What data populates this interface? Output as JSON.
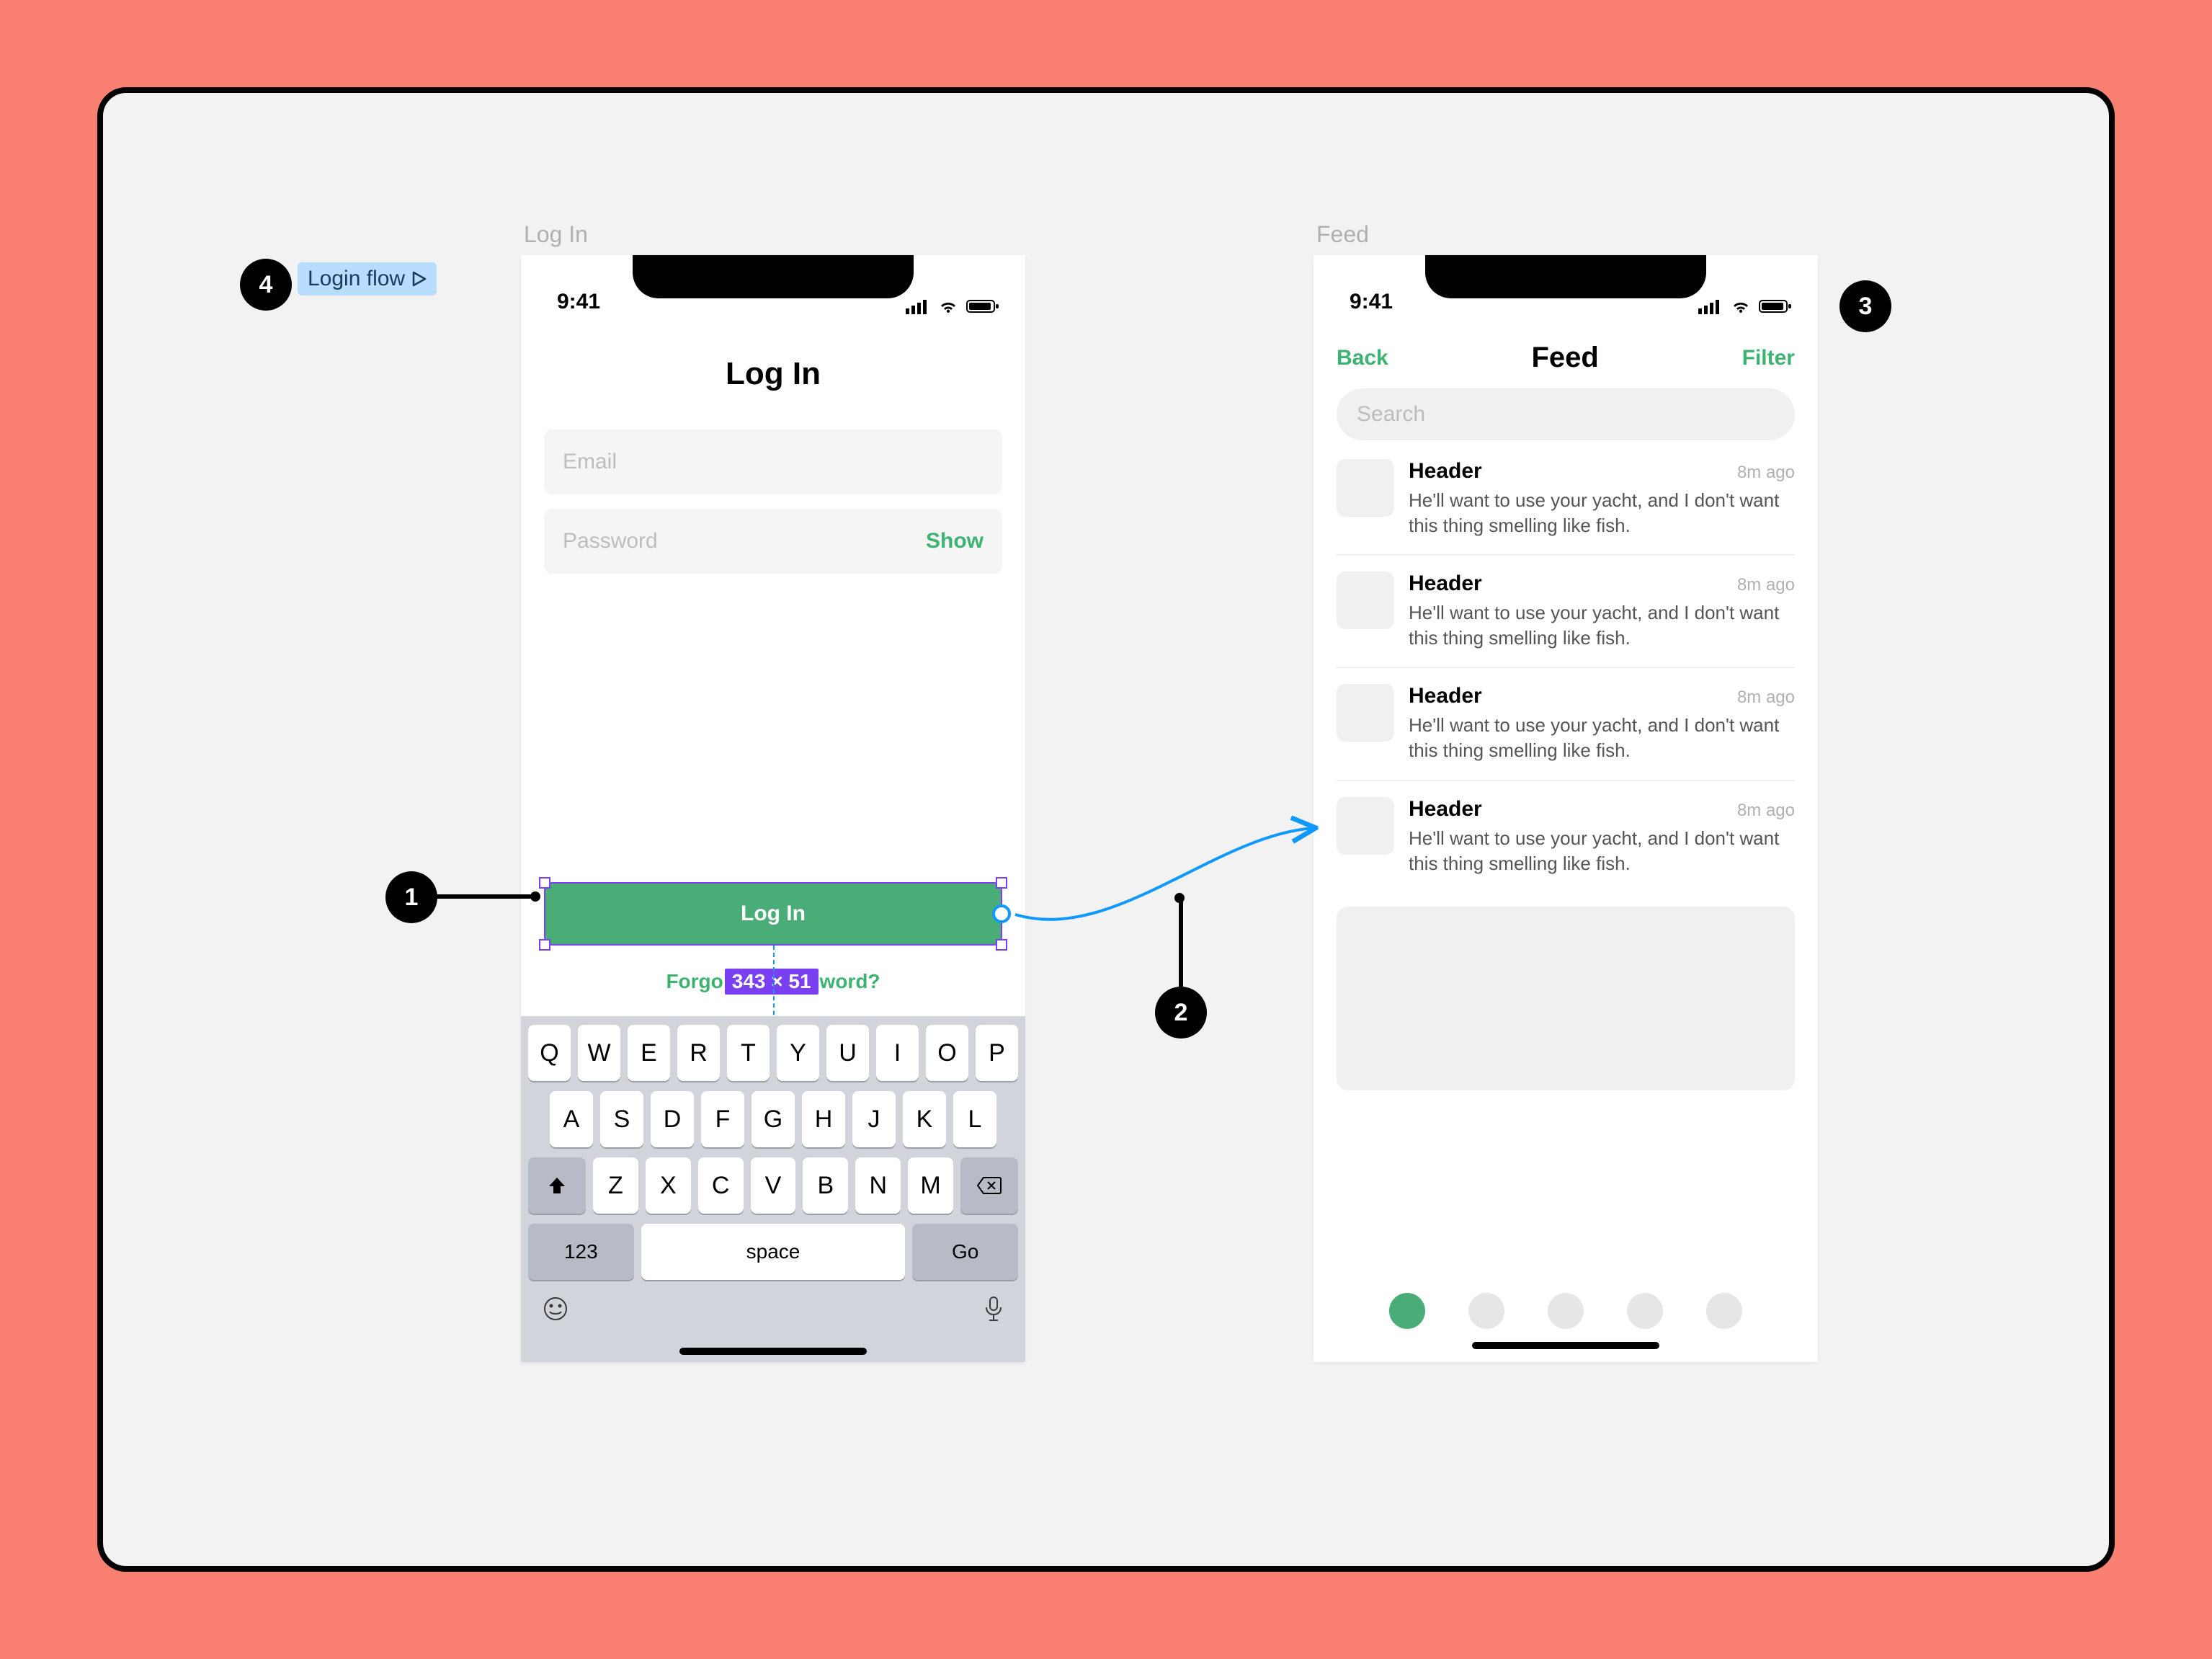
{
  "flow_chip": {
    "label": "Login flow"
  },
  "frames": {
    "login_label": "Log In",
    "feed_label": "Feed"
  },
  "status_time": "9:41",
  "login_screen": {
    "title": "Log In",
    "email_placeholder": "Email",
    "password_placeholder": "Password",
    "show_label": "Show",
    "button_label": "Log In",
    "size_badge": "343 × 51",
    "forgot_prefix": "Forgo",
    "forgot_suffix": "word?"
  },
  "keyboard": {
    "row1": [
      "Q",
      "W",
      "E",
      "R",
      "T",
      "Y",
      "U",
      "I",
      "O",
      "P"
    ],
    "row2": [
      "A",
      "S",
      "D",
      "F",
      "G",
      "H",
      "J",
      "K",
      "L"
    ],
    "row3": [
      "Z",
      "X",
      "C",
      "V",
      "B",
      "N",
      "M"
    ],
    "num_key": "123",
    "space_key": "space",
    "go_key": "Go"
  },
  "feed_screen": {
    "back": "Back",
    "title": "Feed",
    "filter": "Filter",
    "search_placeholder": "Search",
    "items": [
      {
        "header": "Header",
        "time": "8m ago",
        "body": "He'll want to use your yacht, and I don't want this thing smelling like fish."
      },
      {
        "header": "Header",
        "time": "8m ago",
        "body": "He'll want to use your yacht, and I don't want this thing smelling like fish."
      },
      {
        "header": "Header",
        "time": "8m ago",
        "body": "He'll want to use your yacht, and I don't want this thing smelling like fish."
      },
      {
        "header": "Header",
        "time": "8m ago",
        "body": "He'll want to use your yacht, and I don't want this thing smelling like fish."
      }
    ]
  },
  "annotations": {
    "a1": "1",
    "a2": "2",
    "a3": "3",
    "a4": "4"
  }
}
